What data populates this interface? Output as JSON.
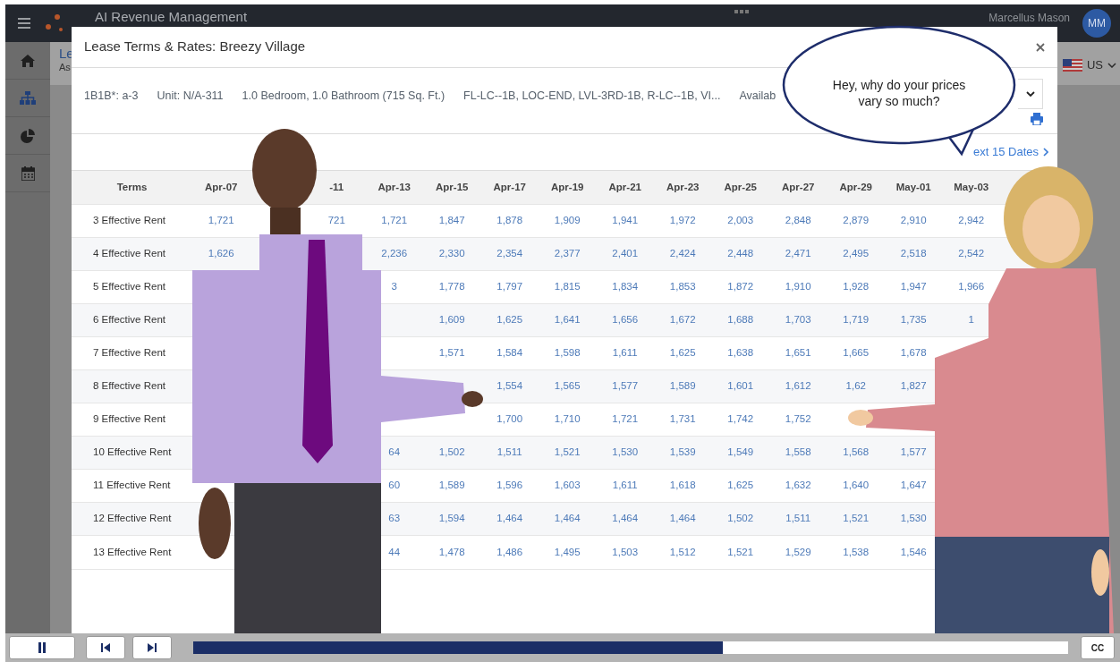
{
  "app": {
    "title": "AI Revenue Management",
    "user": "Marcellus Mason",
    "avatar": "MM",
    "breadcrumb": [
      "Le",
      "As"
    ],
    "region": "US"
  },
  "modal": {
    "title": "Lease Terms & Rates: Breezy Village",
    "info": [
      "1B1B*: a-3",
      "Unit: N/A-311",
      "1.0 Bedroom, 1.0 Bathroom (715 Sq. Ft.)",
      "FL-LC--1B, LOC-END, LVL-3RD-1B, R-LC--1B, VI...",
      "Availab"
    ],
    "next_link": "ext 15 Dates",
    "table": {
      "term_header": "Terms",
      "columns": [
        {
          "label": "Apr-07"
        },
        {},
        {
          "label": "-11"
        },
        {
          "label": "Apr-13"
        },
        {
          "label": "Apr-15"
        },
        {
          "label": "Apr-17"
        },
        {
          "label": "Apr-19"
        },
        {
          "label": "Apr-21"
        },
        {
          "label": "Apr-23"
        },
        {
          "label": "Apr-25"
        },
        {
          "label": "Apr-27"
        },
        {
          "label": "Apr-29"
        },
        {
          "label": "May-01"
        },
        {
          "label": "May-03"
        }
      ],
      "rows": [
        {
          "term": "3 Effective Rent",
          "cells": [
            {
              "text": "1,721"
            },
            {},
            {
              "text": "721"
            },
            {
              "text": "1,721"
            },
            {
              "text": "1,847"
            },
            {
              "text": "1,878"
            },
            {
              "text": "1,909"
            },
            {
              "text": "1,941"
            },
            {
              "text": "1,972"
            },
            {
              "text": "2,003"
            },
            {
              "text": "2,848"
            },
            {
              "text": "2,879"
            },
            {
              "text": "2,910"
            },
            {
              "text": "2,942"
            }
          ]
        },
        {
          "term": "4 Effective Rent",
          "cells": [
            {
              "text": "1,626"
            },
            {},
            {},
            {
              "text": "2,236"
            },
            {
              "text": "2,330"
            },
            {
              "text": "2,354"
            },
            {
              "text": "2,377"
            },
            {
              "text": "2,401"
            },
            {
              "text": "2,424"
            },
            {
              "text": "2,448"
            },
            {
              "text": "2,471"
            },
            {
              "text": "2,495"
            },
            {
              "text": "2,518"
            },
            {
              "text": "2,542"
            }
          ]
        },
        {
          "term": "5 Effective Rent",
          "cells": [
            {},
            {},
            {},
            {
              "text": "3"
            },
            {
              "text": "1,778"
            },
            {
              "text": "1,797"
            },
            {
              "text": "1,815"
            },
            {
              "text": "1,834"
            },
            {
              "text": "1,853"
            },
            {
              "text": "1,872"
            },
            {
              "text": "1,910"
            },
            {
              "text": "1,928"
            },
            {
              "text": "1,947"
            },
            {
              "text": "1,966"
            }
          ]
        },
        {
          "term": "6 Effective Rent",
          "cells": [
            {},
            {},
            {},
            {},
            {
              "text": "1,609"
            },
            {
              "text": "1,625"
            },
            {
              "text": "1,641"
            },
            {
              "text": "1,656"
            },
            {
              "text": "1,672"
            },
            {
              "text": "1,688"
            },
            {
              "text": "1,703"
            },
            {
              "text": "1,719"
            },
            {
              "text": "1,735"
            },
            {
              "text": "1"
            }
          ]
        },
        {
          "term": "7 Effective Rent",
          "cells": [
            {},
            {},
            {},
            {},
            {
              "text": "1,571"
            },
            {
              "text": "1,584"
            },
            {
              "text": "1,598"
            },
            {
              "text": "1,611"
            },
            {
              "text": "1,625"
            },
            {
              "text": "1,638"
            },
            {
              "text": "1,651"
            },
            {
              "text": "1,665"
            },
            {
              "text": "1,678"
            }
          ]
        },
        {
          "term": "8 Effective Rent",
          "cells": [
            {},
            {},
            {},
            {},
            {},
            {
              "text": "1,554"
            },
            {
              "text": "1,565"
            },
            {
              "text": "1,577"
            },
            {
              "text": "1,589"
            },
            {
              "text": "1,601"
            },
            {
              "text": "1,612"
            },
            {
              "text": "1,62"
            },
            {
              "text": "1,827"
            }
          ]
        },
        {
          "term": "9 Effective Rent",
          "cells": [
            {},
            {},
            {},
            {},
            {},
            {
              "text": "1,700"
            },
            {
              "text": "1,710"
            },
            {
              "text": "1,721"
            },
            {
              "text": "1,731"
            },
            {
              "text": "1,742"
            },
            {
              "text": "1,752"
            }
          ]
        },
        {
          "term": "10 Effective Rent",
          "cells": [
            {},
            {},
            {},
            {
              "text": "64"
            },
            {
              "text": "1,502"
            },
            {
              "text": "1,511"
            },
            {
              "text": "1,521"
            },
            {
              "text": "1,530"
            },
            {
              "text": "1,539"
            },
            {
              "text": "1,549"
            },
            {
              "text": "1,558"
            },
            {
              "text": "1,568"
            },
            {
              "text": "1,577"
            }
          ]
        },
        {
          "term": "11 Effective Rent",
          "cells": [
            {},
            {},
            {},
            {
              "text": "60"
            },
            {
              "text": "1,589"
            },
            {
              "text": "1,596"
            },
            {
              "text": "1,603"
            },
            {
              "text": "1,611"
            },
            {
              "text": "1,618"
            },
            {
              "text": "1,625"
            },
            {
              "text": "1,632"
            },
            {
              "text": "1,640"
            },
            {
              "text": "1,647"
            }
          ]
        },
        {
          "term": "12 Effective Rent",
          "cells": [
            {},
            {},
            {},
            {
              "text": "63"
            },
            {
              "text": "1,594"
            },
            {
              "text": "1,464"
            },
            {
              "text": "1,464"
            },
            {
              "text": "1,464"
            },
            {
              "text": "1,464"
            },
            {
              "text": "1,502"
            },
            {
              "text": "1,511"
            },
            {
              "text": "1,521"
            },
            {
              "text": "1,530"
            }
          ]
        },
        {
          "term": "13 Effective Rent",
          "cells": [
            {},
            {},
            {},
            {
              "text": "44"
            },
            {
              "text": "1,478"
            },
            {
              "text": "1,486"
            },
            {
              "text": "1,495"
            },
            {
              "text": "1,503"
            },
            {
              "text": "1,512"
            },
            {
              "text": "1,521"
            },
            {
              "text": "1,529"
            },
            {
              "text": "1,538"
            },
            {
              "text": "1,546"
            }
          ]
        }
      ]
    }
  },
  "speech_bubble": {
    "text": "Hey, why do your prices vary so much?"
  },
  "player": {
    "level": 0.605,
    "captions": "CC"
  }
}
